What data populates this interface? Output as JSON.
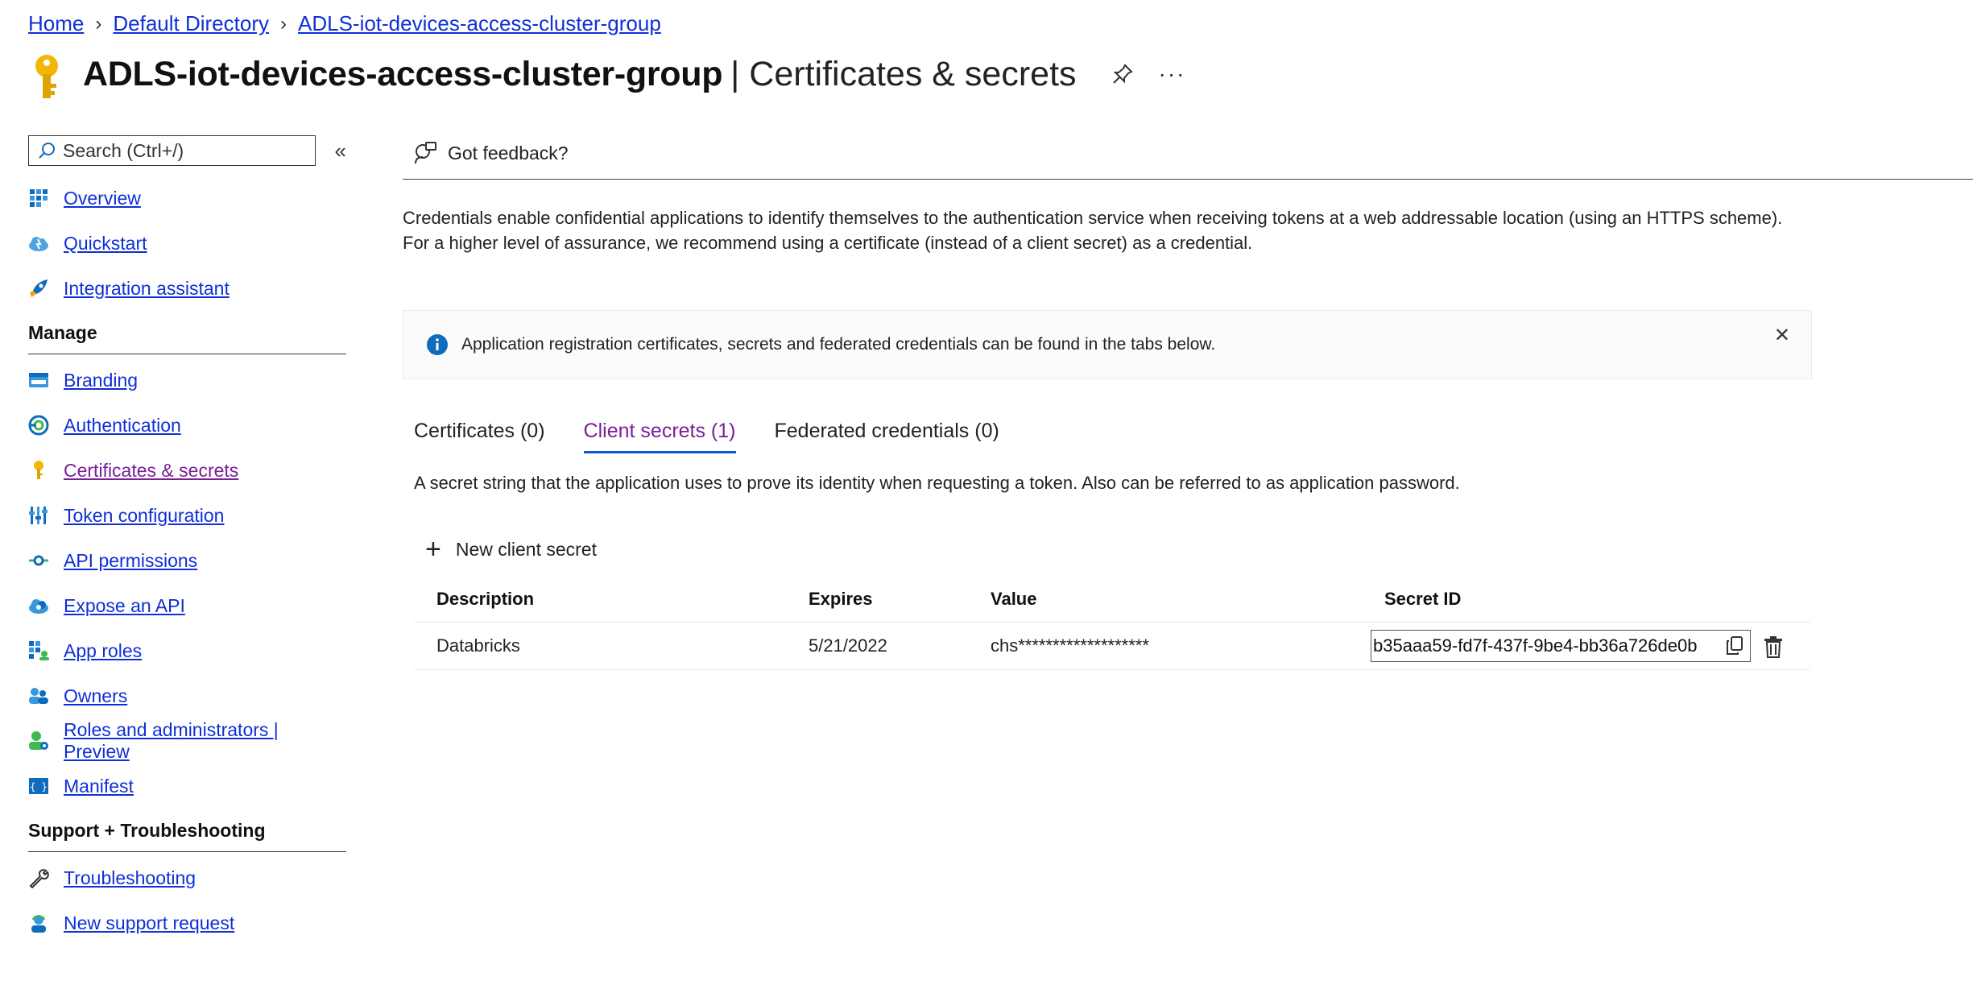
{
  "breadcrumb": {
    "items": [
      "Home",
      "Default Directory",
      "ADLS-iot-devices-access-cluster-group"
    ]
  },
  "header": {
    "title": "ADLS-iot-devices-access-cluster-group",
    "subtitle": "| Certificates & secrets",
    "more": "···"
  },
  "sidebar": {
    "search_placeholder": "Search (Ctrl+/)",
    "collapse": "«",
    "top_items": [
      {
        "label": "Overview",
        "icon": "overview-grid-icon"
      },
      {
        "label": "Quickstart",
        "icon": "quickstart-cloud-icon"
      },
      {
        "label": "Integration assistant",
        "icon": "rocket-icon"
      }
    ],
    "manage_heading": "Manage",
    "manage_items": [
      {
        "label": "Branding",
        "icon": "branding-icon"
      },
      {
        "label": "Authentication",
        "icon": "authentication-icon"
      },
      {
        "label": "Certificates & secrets",
        "icon": "key-icon",
        "active": true
      },
      {
        "label": "Token configuration",
        "icon": "token-bars-icon"
      },
      {
        "label": "API permissions",
        "icon": "api-permissions-icon"
      },
      {
        "label": "Expose an API",
        "icon": "expose-api-cloud-icon"
      },
      {
        "label": "App roles",
        "icon": "app-roles-icon"
      },
      {
        "label": "Owners",
        "icon": "owners-icon"
      },
      {
        "label": "Roles and administrators | Preview",
        "icon": "roles-admin-icon"
      },
      {
        "label": "Manifest",
        "icon": "manifest-icon"
      }
    ],
    "support_heading": "Support + Troubleshooting",
    "support_items": [
      {
        "label": "Troubleshooting",
        "icon": "wrench-icon"
      },
      {
        "label": "New support request",
        "icon": "support-person-icon"
      }
    ]
  },
  "main": {
    "feedback_label": "Got feedback?",
    "description": "Credentials enable confidential applications to identify themselves to the authentication service when receiving tokens at a web addressable location (using an HTTPS scheme). For a higher level of assurance, we recommend using a certificate (instead of a client secret) as a credential.",
    "info_message": "Application registration certificates, secrets and federated credentials can be found in the tabs below.",
    "close_glyph": "✕",
    "tabs": [
      {
        "label": "Certificates (0)"
      },
      {
        "label": "Client secrets (1)",
        "active": true
      },
      {
        "label": "Federated credentials (0)"
      }
    ],
    "tab_description": "A secret string that the application uses to prove its identity when requesting a token. Also can be referred to as application password.",
    "new_secret_label": "New client secret",
    "table": {
      "headers": [
        "Description",
        "Expires",
        "Value",
        "Secret ID"
      ],
      "rows": [
        {
          "description": "Databricks",
          "expires": "5/21/2022",
          "value": "chs*******************",
          "secret_id": "b35aaa59-fd7f-437f-9be4-bb36a726de0b"
        }
      ]
    }
  },
  "colors": {
    "link": "#0f2fd8",
    "active_link": "#7a1f98",
    "tab_underline": "#0f58d6",
    "info_blue": "#0f6cbd",
    "key_gold": "#f2b705"
  }
}
